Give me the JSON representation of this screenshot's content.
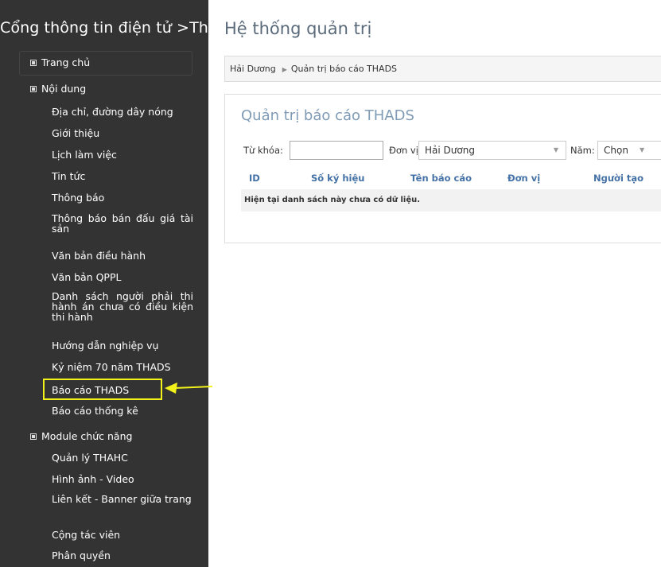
{
  "sidebar": {
    "site_title": "Cổng thông tin điện tử >Thi",
    "sections": [
      {
        "label": "Trang chủ"
      },
      {
        "label": "Nội dung"
      },
      {
        "label": "Module chức năng"
      }
    ],
    "content_items": [
      {
        "label": "Địa chỉ, đường dây nóng"
      },
      {
        "label": "Giới thiệu"
      },
      {
        "label": "Lịch làm việc"
      },
      {
        "label": "Tin tức"
      },
      {
        "label": "Thông báo"
      },
      {
        "label": "Thông báo bán đấu giá tài sản"
      },
      {
        "label": "Văn bản điều hành"
      },
      {
        "label": "Văn bản QPPL"
      },
      {
        "label": "Danh sách người phải thi hành án chưa có điều kiện thi hành"
      },
      {
        "label": "Hướng dẫn nghiệp vụ"
      },
      {
        "label": "Kỷ niệm 70 năm THADS"
      },
      {
        "label": "Báo cáo THADS"
      },
      {
        "label": "Báo cáo thống kê"
      }
    ],
    "module_items": [
      {
        "label": "Quản lý THAHC"
      },
      {
        "label": "Hình ảnh - Video"
      },
      {
        "label": "Liên kết - Banner giữa trang"
      },
      {
        "label": "Cộng tác viên"
      },
      {
        "label": "Phân quyền"
      }
    ],
    "highlight_color": "#f2f21a"
  },
  "main": {
    "page_title": "Hệ thống quản trị",
    "breadcrumb": [
      "Hải Dương",
      "Quản trị báo cáo THADS"
    ],
    "panel": {
      "title": "Quản trị báo cáo THADS",
      "keyword_label": "Từ khóa:",
      "keyword_value": "",
      "unit_label": "Đơn vị",
      "unit_value": "Hải Dương",
      "year_label": "Năm:",
      "year_value": "Chọn",
      "columns": [
        "ID",
        "Số ký hiệu",
        "Tên báo cáo",
        "Đơn vị",
        "Người tạo"
      ],
      "empty_message": "Hiện tại danh sách này chưa có dữ liệu."
    },
    "accent_color": "#4472a6"
  }
}
